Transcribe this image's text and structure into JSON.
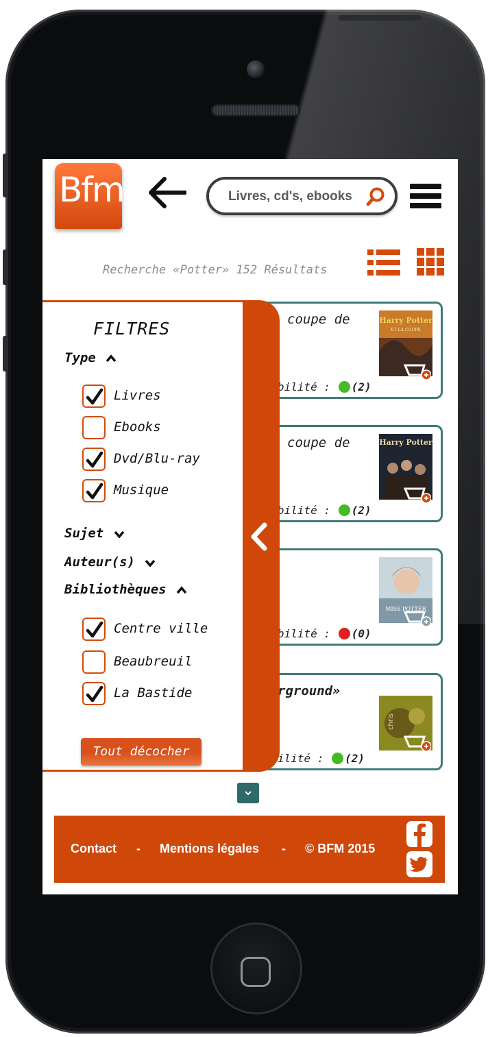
{
  "header": {
    "logo_text": "Bfm",
    "search_placeholder": "Livres, cd's, ebooks",
    "results_info": "Recherche «Potter» 152 Résultats"
  },
  "results": [
    {
      "title": "coupe de",
      "availability_label": "bilité :",
      "count": "(2)",
      "status_color": "#44bb22",
      "cover": "harry-potter-coupe-de-feu-cover"
    },
    {
      "title": "coupe de",
      "availability_label": "bilité :",
      "count": "(2)",
      "status_color": "#44bb22",
      "cover": "harry-potter-goblet-of-fire-film-cover"
    },
    {
      "title": "",
      "availability_label": "bilité :",
      "count": "(0)",
      "status_color": "#dd2222",
      "cover": "miss-potter-cover"
    },
    {
      "title": "rground»",
      "availability_label": "ilité :",
      "count": "(2)",
      "status_color": "#44bb22",
      "cover": "chris-potter-underground-cover"
    }
  ],
  "filters": {
    "title": "FILTRES",
    "groups": [
      {
        "label": "Type",
        "expanded": true
      },
      {
        "label": "Sujet",
        "expanded": false
      },
      {
        "label": "Auteur(s)",
        "expanded": false
      },
      {
        "label": "Bibliothèques",
        "expanded": true
      }
    ],
    "type_options": [
      {
        "label": "Livres",
        "checked": true
      },
      {
        "label": "Ebooks",
        "checked": false
      },
      {
        "label": "Dvd/Blu-ray",
        "checked": true
      },
      {
        "label": "Musique",
        "checked": true
      }
    ],
    "library_options": [
      {
        "label": "Centre ville",
        "checked": true
      },
      {
        "label": "Beaubreuil",
        "checked": false
      },
      {
        "label": "La Bastide",
        "checked": true
      }
    ],
    "uncheck_all": "Tout décocher"
  },
  "footer": {
    "contact": "Contact",
    "sep1": "-",
    "legal": "Mentions légales",
    "sep2": "-",
    "copyright": "© BFM 2015"
  },
  "colors": {
    "brand_orange": "#d0470a",
    "teal": "#3f7a78"
  }
}
